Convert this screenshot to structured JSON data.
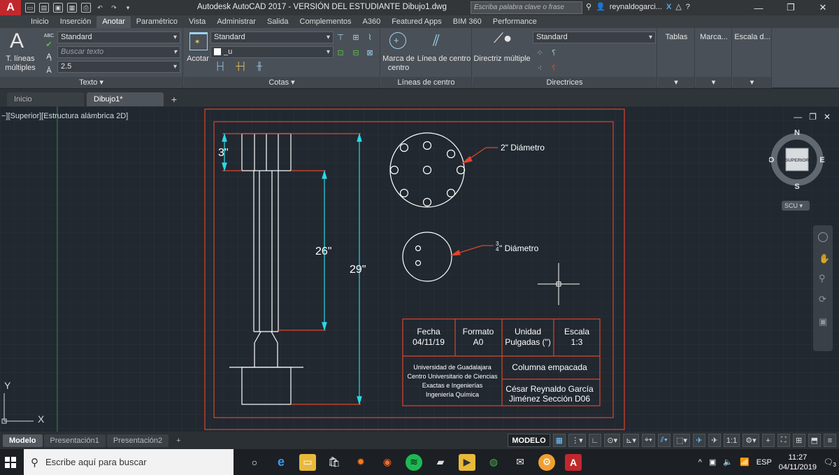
{
  "window": {
    "title": "Autodesk AutoCAD 2017 - VERSIÓN DEL ESTUDIANTE    Dibujo1.dwg",
    "app_logo": "A",
    "search_placeholder": "Escriba palabra clave o frase",
    "user": "reynaldogarci..."
  },
  "ribbon_tabs": [
    "Inicio",
    "Inserción",
    "Anotar",
    "Paramétrico",
    "Vista",
    "Administrar",
    "Salida",
    "Complementos",
    "A360",
    "Featured Apps",
    "BIM 360",
    "Performance"
  ],
  "active_ribbon_tab": "Anotar",
  "ribbon": {
    "texto": {
      "title": "Texto",
      "big_label_1": "T. líneas",
      "big_label_2": "múltiples",
      "style": "Standard",
      "find_placeholder": "Buscar texto",
      "height": "2.5",
      "abc": "ABC"
    },
    "cotas": {
      "title": "Cotas",
      "acotar_label": "Acotar",
      "style": "Standard",
      "layer": "_u"
    },
    "lineas_centro": {
      "title": "Líneas de centro",
      "marca_label_1": "Marca de",
      "marca_label_2": "centro",
      "linea_label": "Línea de centro"
    },
    "directrices": {
      "title": "Directrices",
      "directriz_label": "Directriz múltiple",
      "style": "Standard"
    },
    "extra_panels": [
      "Tablas",
      "Marca...",
      "Escala d..."
    ]
  },
  "doc_tabs": [
    {
      "label": "Inicio",
      "active": false
    },
    {
      "label": "Dibujo1*",
      "active": true
    }
  ],
  "viewport": {
    "label": "−][Superior][Estructura alámbrica 2D]",
    "viewcube": {
      "n": "N",
      "s": "S",
      "e": "E",
      "o": "O",
      "face": "SUPERIOR"
    },
    "scu": "SCU",
    "ucs_x": "X",
    "ucs_y": "Y"
  },
  "drawing": {
    "dim_3": "3\"",
    "dim_26": "26\"",
    "dim_29": "29\"",
    "label_2in": "2\" Diámetro",
    "label_34": "\" Diámetro",
    "frac_num": "3",
    "frac_den": "4",
    "table": {
      "headers": [
        {
          "h": "Fecha",
          "v": "04/11/19"
        },
        {
          "h": "Formato",
          "v": "A0"
        },
        {
          "h": "Unidad",
          "v": "Pulgadas (\")"
        },
        {
          "h": "Escala",
          "v": "1:3"
        }
      ],
      "university": [
        "Universidad de Guadalajara",
        "Centro Universitario de Ciencias",
        "Exactas e Ingenierías",
        "Ingeniería Química"
      ],
      "project": "Columna empacada",
      "author_1": "César Reynaldo García",
      "author_2": "Jiménez     Sección D06"
    }
  },
  "layout_tabs": [
    {
      "label": "Modelo",
      "active": true
    },
    {
      "label": "Presentación1",
      "active": false
    },
    {
      "label": "Presentación2",
      "active": false
    }
  ],
  "status": {
    "model": "MODELO",
    "scale": "1:1"
  },
  "taskbar": {
    "search_placeholder": "Escribe aquí para buscar",
    "lang": "ESP",
    "time": "11:27",
    "date": "04/11/2019",
    "notif_count": "3"
  },
  "colors": {
    "ribbon": "#4a5057",
    "canvas": "#212830",
    "border_red": "#e0442a",
    "cyan": "#2ad9e8",
    "white_lines": "#ffffff",
    "autocad_red": "#c0282d"
  }
}
